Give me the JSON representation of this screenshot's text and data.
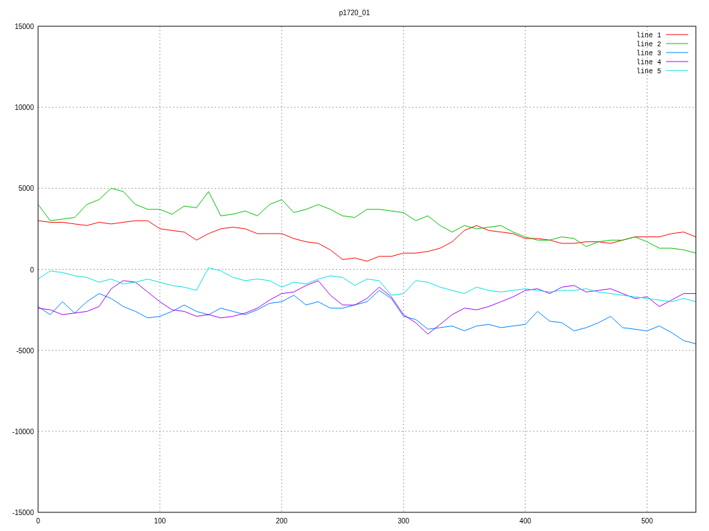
{
  "chart_data": {
    "type": "line",
    "title": "p1720_01",
    "x": [
      0,
      10,
      20,
      30,
      40,
      50,
      60,
      70,
      80,
      90,
      100,
      110,
      120,
      130,
      140,
      150,
      160,
      170,
      180,
      190,
      200,
      210,
      220,
      230,
      240,
      250,
      260,
      270,
      280,
      290,
      300,
      310,
      320,
      330,
      340,
      350,
      360,
      370,
      380,
      390,
      400,
      410,
      420,
      430,
      440,
      450,
      460,
      470,
      480,
      490,
      500,
      510,
      520,
      530,
      540
    ],
    "series": [
      {
        "name": "line 1",
        "color": "#ff0000",
        "values": [
          3000,
          2900,
          2900,
          2800,
          2700,
          2900,
          2800,
          2900,
          3000,
          3000,
          2500,
          2400,
          2300,
          1800,
          2200,
          2500,
          2600,
          2500,
          2200,
          2200,
          2200,
          1900,
          1700,
          1600,
          1200,
          600,
          700,
          500,
          800,
          800,
          1000,
          1000,
          1100,
          1300,
          1700,
          2400,
          2700,
          2400,
          2300,
          2200,
          1900,
          1900,
          1800,
          1600,
          1600,
          1700,
          1700,
          1600,
          1800,
          2000,
          2000,
          2000,
          2200,
          2300,
          2000
        ]
      },
      {
        "name": "line 2",
        "color": "#00c000",
        "values": [
          4000,
          3000,
          3100,
          3200,
          4000,
          4300,
          5000,
          4800,
          4000,
          3700,
          3700,
          3400,
          3900,
          3800,
          4800,
          3300,
          3400,
          3600,
          3300,
          4000,
          4300,
          3500,
          3700,
          4000,
          3700,
          3300,
          3200,
          3700,
          3700,
          3600,
          3500,
          3000,
          3300,
          2700,
          2300,
          2700,
          2500,
          2600,
          2700,
          2300,
          2000,
          1800,
          1800,
          2000,
          1900,
          1400,
          1700,
          1800,
          1800,
          2000,
          1700,
          1300,
          1300,
          1200,
          1000
        ]
      },
      {
        "name": "line 3",
        "color": "#0080ff",
        "values": [
          -2300,
          -2800,
          -2000,
          -2700,
          -2000,
          -1500,
          -1800,
          -2300,
          -2600,
          -3000,
          -2900,
          -2600,
          -2200,
          -2600,
          -2800,
          -2400,
          -2600,
          -2800,
          -2500,
          -2100,
          -2000,
          -1600,
          -2200,
          -2000,
          -2400,
          -2400,
          -2200,
          -2000,
          -1300,
          -1800,
          -2900,
          -3100,
          -3700,
          -3600,
          -3500,
          -3800,
          -3500,
          -3400,
          -3600,
          -3500,
          -3400,
          -2600,
          -3200,
          -3300,
          -3800,
          -3600,
          -3300,
          -2900,
          -3600,
          -3700,
          -3800,
          -3500,
          -3900,
          -4400,
          -4600
        ]
      },
      {
        "name": "line 4",
        "color": "#a000ff",
        "values": [
          -2400,
          -2500,
          -2800,
          -2700,
          -2600,
          -2300,
          -1200,
          -700,
          -800,
          -1400,
          -2000,
          -2500,
          -2600,
          -2900,
          -2800,
          -3000,
          -2900,
          -2700,
          -2400,
          -1900,
          -1500,
          -1400,
          -1000,
          -700,
          -1600,
          -2200,
          -2200,
          -1800,
          -1100,
          -1700,
          -2800,
          -3300,
          -4000,
          -3400,
          -2800,
          -2400,
          -2500,
          -2300,
          -2000,
          -1700,
          -1300,
          -1200,
          -1500,
          -1100,
          -1000,
          -1400,
          -1300,
          -1200,
          -1500,
          -1800,
          -1700,
          -2300,
          -1900,
          -1500,
          -1500
        ]
      },
      {
        "name": "line 5",
        "color": "#00e0e0",
        "values": [
          -600,
          -100,
          -200,
          -400,
          -500,
          -800,
          -600,
          -900,
          -800,
          -600,
          -800,
          -1000,
          -1100,
          -1300,
          100,
          -100,
          -500,
          -700,
          -600,
          -700,
          -1100,
          -800,
          -900,
          -600,
          -400,
          -500,
          -1000,
          -600,
          -700,
          -1600,
          -1500,
          -700,
          -800,
          -1100,
          -1300,
          -1500,
          -1100,
          -1300,
          -1400,
          -1300,
          -1200,
          -1300,
          -1400,
          -1300,
          -1300,
          -1200,
          -1400,
          -1500,
          -1600,
          -1700,
          -1800,
          -1900,
          -2000,
          -1800,
          -2000
        ]
      }
    ],
    "grid": true,
    "legend": true,
    "xlim": [
      0,
      540
    ],
    "ylim": [
      -15000,
      15000
    ],
    "xticks": [
      0,
      100,
      200,
      300,
      400,
      500
    ],
    "yticks": [
      -15000,
      -10000,
      -5000,
      0,
      5000,
      10000,
      15000
    ]
  }
}
